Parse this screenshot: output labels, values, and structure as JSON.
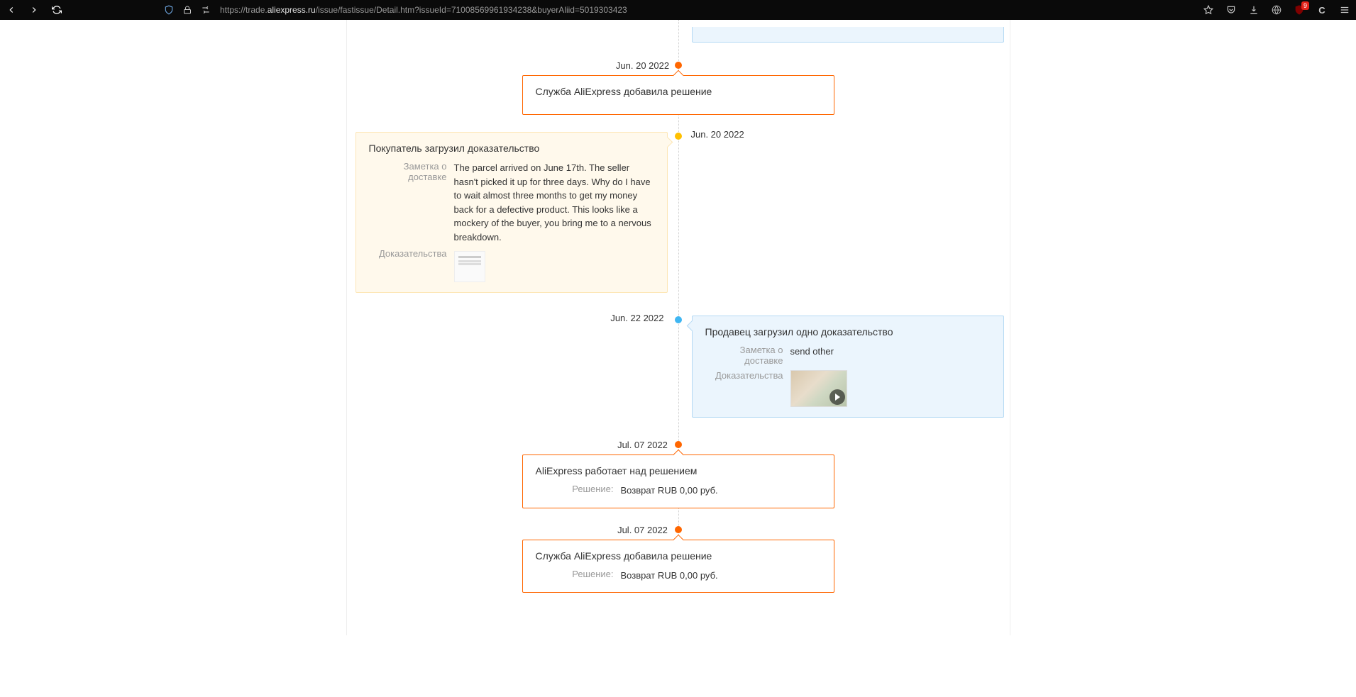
{
  "browser": {
    "url_prefix": "https://trade.",
    "url_domain": "aliexpress.ru",
    "url_path": "/issue/fastissue/Detail.htm?issueId=71008569961934238&buyerAliid=5019303423",
    "badge_count": "9"
  },
  "labels": {
    "delivery_note": "Заметка о доставке",
    "evidence": "Доказательства",
    "decision": "Решение:"
  },
  "timeline": {
    "event1": {
      "date": "Jun. 20 2022",
      "title": "Служба AliExpress добавила решение"
    },
    "event2": {
      "date": "Jun. 20 2022",
      "title": "Покупатель загрузил доказательство",
      "note": "The parcel arrived on June 17th. The seller hasn't picked it up for three days. Why do I have to wait almost three months to get my money back for a defective product. This looks like a mockery of the buyer, you bring me to a nervous breakdown."
    },
    "event3": {
      "date": "Jun. 22 2022",
      "title": "Продавец загрузил одно доказательство",
      "note": "send other"
    },
    "event4": {
      "date": "Jul. 07 2022",
      "title": "AliExpress работает над решением",
      "decision": "Возврат RUB 0,00 руб."
    },
    "event5": {
      "date": "Jul. 07 2022",
      "title": "Служба AliExpress добавила решение",
      "decision": "Возврат RUB 0,00 руб."
    }
  }
}
